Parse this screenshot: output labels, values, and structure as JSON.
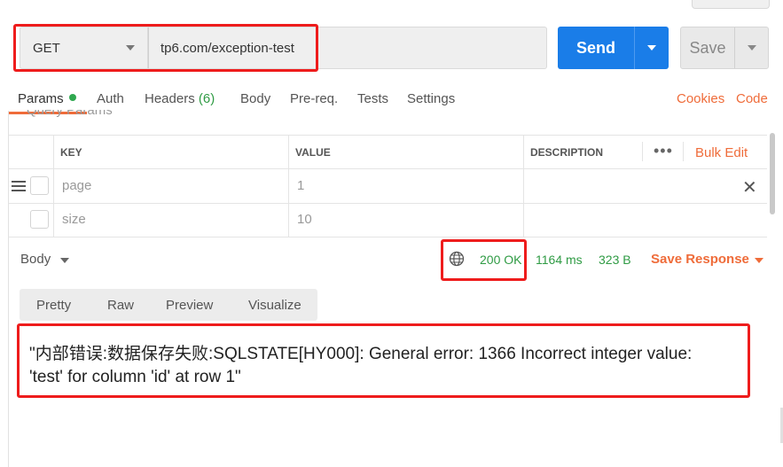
{
  "request": {
    "method": "GET",
    "url": "tp6.com/exception-test",
    "send_label": "Send",
    "save_label": "Save"
  },
  "tabs": {
    "params": "Params",
    "auth": "Auth",
    "headers": "Headers",
    "headers_count": "(6)",
    "body": "Body",
    "prereq": "Pre-req.",
    "tests": "Tests",
    "settings": "Settings",
    "cookies": "Cookies",
    "code": "Code"
  },
  "query_params": {
    "title": "Query Params",
    "headers": {
      "key": "KEY",
      "value": "VALUE",
      "description": "DESCRIPTION"
    },
    "more": "•••",
    "bulk_edit": "Bulk Edit",
    "rows": [
      {
        "key": "page",
        "value": "1"
      },
      {
        "key": "size",
        "value": "10"
      }
    ]
  },
  "response": {
    "section_label": "Body",
    "status": "200 OK",
    "time": "1164 ms",
    "size": "323 B",
    "save_response": "Save Response",
    "views": [
      "Pretty",
      "Raw",
      "Preview",
      "Visualize"
    ],
    "body_line1": "\"内部错误:数据保存失败:SQLSTATE[HY000]: General error: 1366 Incorrect integer value:",
    "body_line2": "'test' for column 'id' at row 1\""
  },
  "colors": {
    "accent": "#ef6c3a",
    "primary": "#1a7de8",
    "success": "#2f9b44",
    "highlight": "#ee1c1c"
  }
}
